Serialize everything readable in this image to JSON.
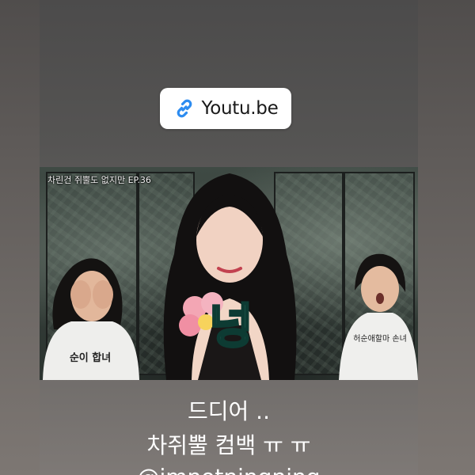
{
  "link_sticker": {
    "label": "Youtu.be",
    "icon": "link-icon",
    "icon_color": "#2d8cf0"
  },
  "video_thumbnail": {
    "title": "차린건 쥐뿔도 없지만 EP.36",
    "sticker_text": "넝",
    "left_shirt_text": "순이 합녀",
    "right_shirt_text": "허순애할마 손녀"
  },
  "caption": {
    "line1": "드디어 ..",
    "line2": "차쥐뿔 컴백 ㅠ ㅠ",
    "line3": "@imnotningning"
  }
}
